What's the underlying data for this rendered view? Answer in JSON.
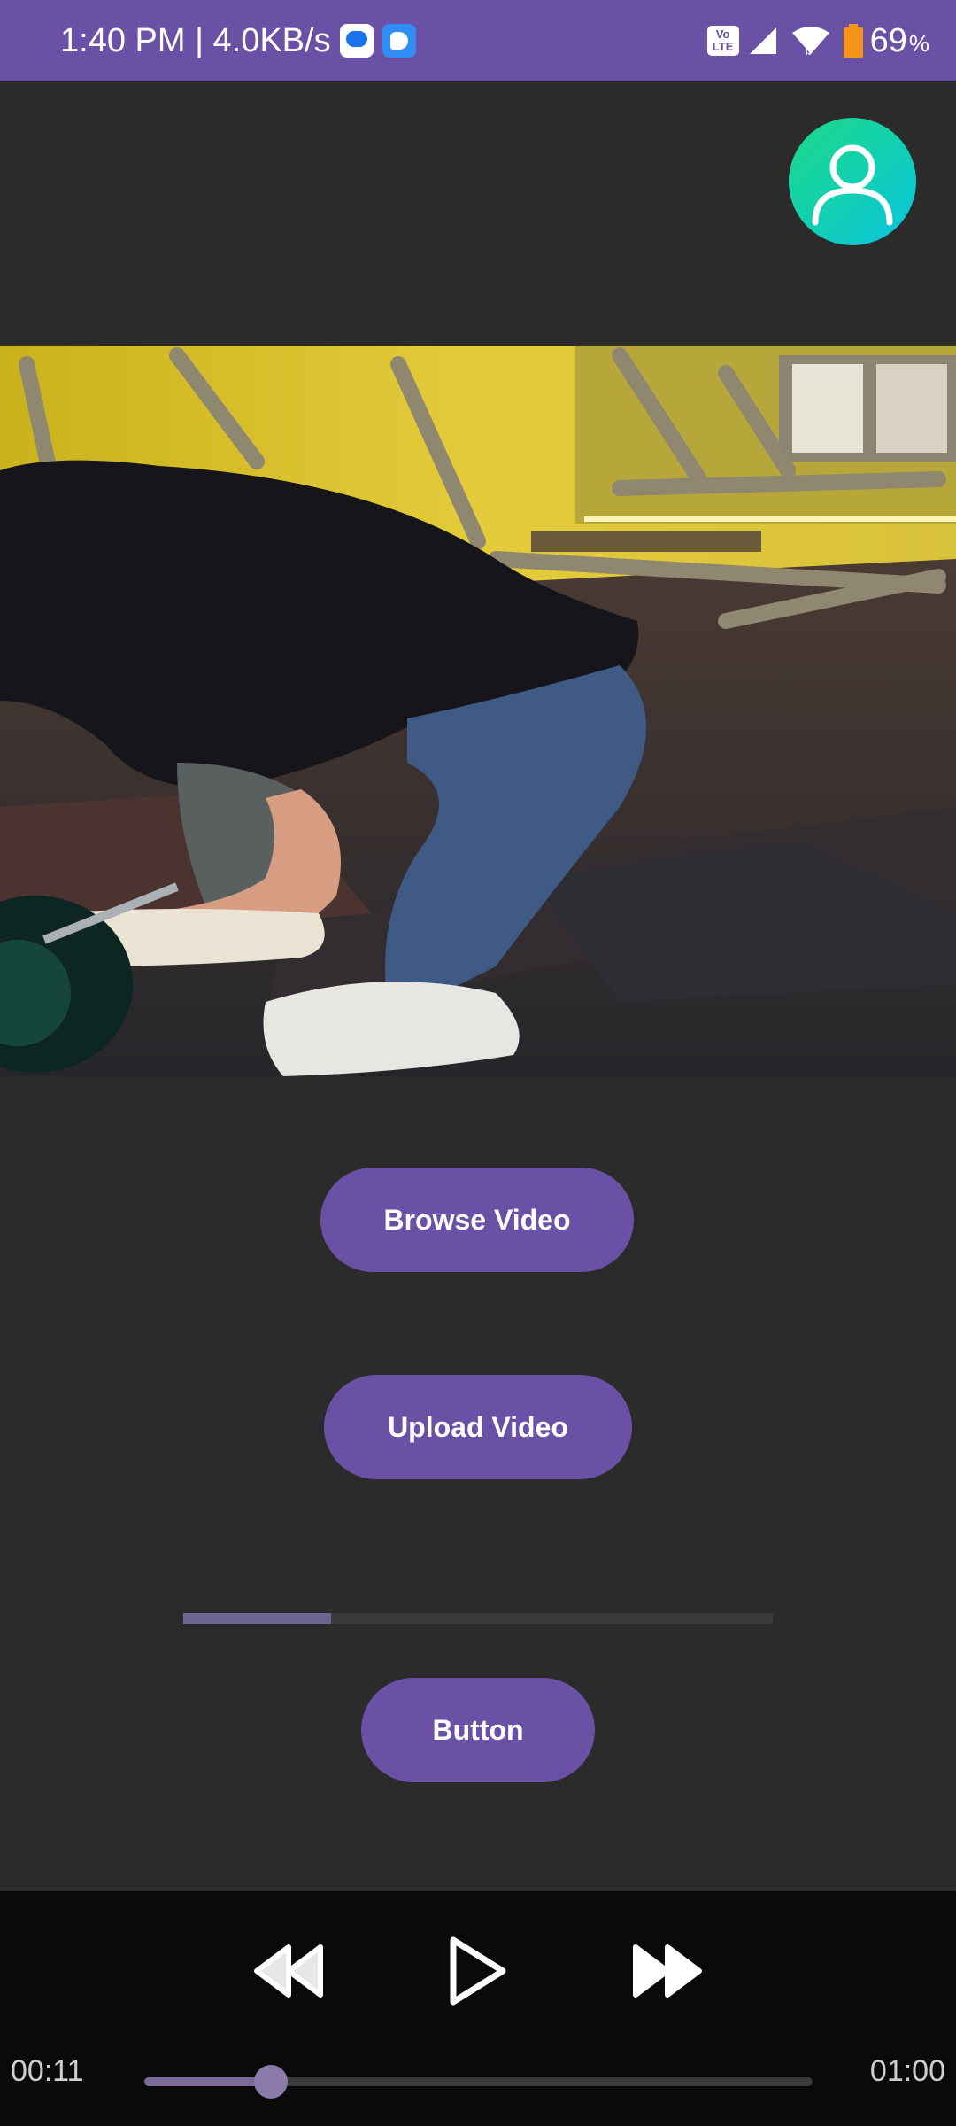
{
  "status_bar": {
    "time_speed": "1:40 PM | 4.0KB/s",
    "network_badge": "Vo LTE",
    "battery_level": "69",
    "battery_unit": "%",
    "icons": [
      "messages-notification-icon",
      "app-notification-icon",
      "volte-icon",
      "signal-icon",
      "wifi-icon",
      "battery-icon"
    ]
  },
  "profile": {
    "icon": "user-profile-icon",
    "colors": [
      "#1ed88a",
      "#0ac3e0"
    ]
  },
  "buttons": {
    "browse_label": "Browse Video",
    "upload_label": "Upload Video",
    "generic_label": "Button"
  },
  "upload_progress": {
    "fraction": 0.25
  },
  "media_controller": {
    "current_time": "00:11",
    "total_time": "01:00",
    "position_fraction": 0.19,
    "icons": [
      "rewind-icon",
      "play-icon",
      "fast-forward-icon"
    ]
  },
  "colors": {
    "accent": "#6a51a6",
    "background": "#2b2b2b",
    "controller_background": "#0a0a0a"
  }
}
